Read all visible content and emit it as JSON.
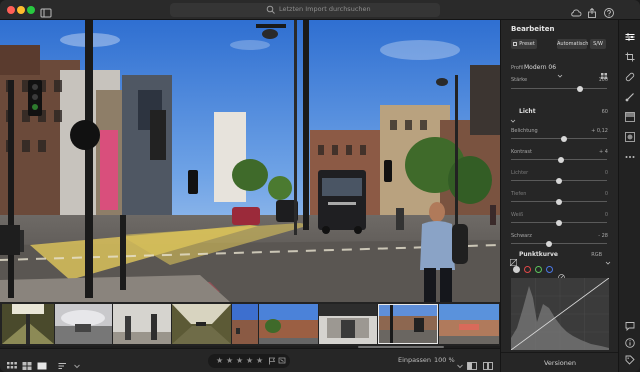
{
  "search": {
    "placeholder": "Letzten Import durchsuchen"
  },
  "panel": {
    "title": "Bearbeiten",
    "preset_label": "Preset",
    "auto_label": "Automatisch",
    "bw_label": "S/W",
    "profile_label": "Profil",
    "profile_value": "Modern 06",
    "strength_label": "Stärke",
    "strength_value": "100",
    "strength_level": 0.72,
    "light_section": "Licht",
    "light_value": "60",
    "sliders": [
      {
        "label": "Belichtung",
        "value": "+ 0,12",
        "level": 0.55,
        "dim": false
      },
      {
        "label": "Kontrast",
        "value": "+ 4",
        "level": 0.52,
        "dim": false
      },
      {
        "label": "Lichter",
        "value": "0",
        "level": 0.5,
        "dim": true
      },
      {
        "label": "Tiefen",
        "value": "0",
        "level": 0.5,
        "dim": true
      },
      {
        "label": "Weiß",
        "value": "0",
        "level": 0.5,
        "dim": true
      },
      {
        "label": "Schwarz",
        "value": "- 28",
        "level": 0.4,
        "dim": false
      }
    ],
    "curve_section": "Punktkurve",
    "curve_value": "RGB",
    "versions_label": "Versionen"
  },
  "bottombar": {
    "fit_label": "Einpassen",
    "zoom_label": "100 %"
  },
  "filmstrip": {
    "selected_index": 7
  },
  "colors": {
    "accent": "#e8e8e8",
    "panel_bg": "#262626",
    "channel_red": "#e04848",
    "channel_green": "#5cc35c",
    "channel_blue": "#4a78e6"
  },
  "icons": {
    "titlebar": [
      "search-icon",
      "sidebar-toggle-icon",
      "share-icon",
      "cloud-sync-icon",
      "help-icon"
    ],
    "tools": [
      "edit-sliders-icon",
      "crop-icon",
      "healing-brush-icon",
      "brush-icon",
      "linear-gradient-icon",
      "radial-gradient-icon",
      "more-icon",
      "comment-icon",
      "info-icon",
      "tag-icon"
    ]
  }
}
